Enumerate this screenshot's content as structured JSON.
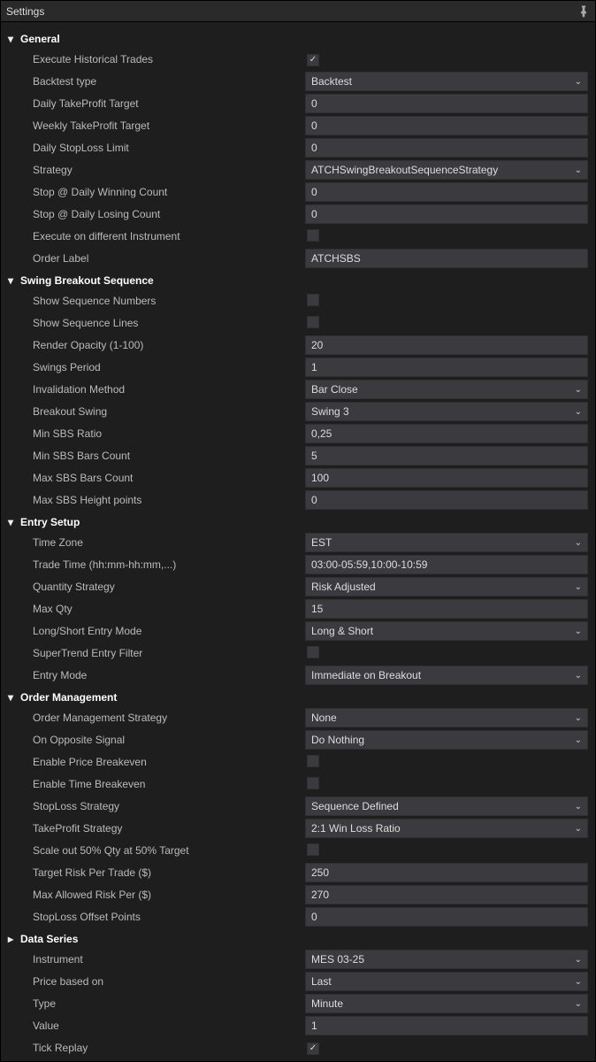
{
  "window": {
    "title": "Settings"
  },
  "sections": {
    "general": {
      "title": "General",
      "execute_historical_trades": {
        "label": "Execute Historical Trades",
        "checked": true
      },
      "backtest_type": {
        "label": "Backtest type",
        "value": "Backtest"
      },
      "daily_tp_target": {
        "label": "Daily TakeProfit Target",
        "value": "0"
      },
      "weekly_tp_target": {
        "label": "Weekly TakeProfit Target",
        "value": "0"
      },
      "daily_sl_limit": {
        "label": "Daily StopLoss Limit",
        "value": "0"
      },
      "strategy": {
        "label": "Strategy",
        "value": "ATCHSwingBreakoutSequenceStrategy"
      },
      "stop_daily_win": {
        "label": "Stop @ Daily Winning Count",
        "value": "0"
      },
      "stop_daily_lose": {
        "label": "Stop @ Daily Losing Count",
        "value": "0"
      },
      "exec_diff_instrument": {
        "label": "Execute on different Instrument",
        "checked": false
      },
      "order_label": {
        "label": "Order Label",
        "value": "ATCHSBS"
      }
    },
    "sbs": {
      "title": "Swing Breakout Sequence",
      "show_seq_numbers": {
        "label": "Show Sequence Numbers",
        "checked": false
      },
      "show_seq_lines": {
        "label": "Show Sequence Lines",
        "checked": false
      },
      "render_opacity": {
        "label": "Render Opacity (1-100)",
        "value": "20"
      },
      "swings_period": {
        "label": "Swings Period",
        "value": "1"
      },
      "invalidation_method": {
        "label": "Invalidation Method",
        "value": "Bar Close"
      },
      "breakout_swing": {
        "label": "Breakout Swing",
        "value": "Swing 3"
      },
      "min_sbs_ratio": {
        "label": "Min SBS Ratio",
        "value": "0,25"
      },
      "min_sbs_bars": {
        "label": "Min SBS Bars Count",
        "value": "5"
      },
      "max_sbs_bars": {
        "label": "Max SBS Bars Count",
        "value": "100"
      },
      "max_sbs_height": {
        "label": "Max SBS Height points",
        "value": "0"
      }
    },
    "entry": {
      "title": "Entry Setup",
      "time_zone": {
        "label": "Time Zone",
        "value": "EST"
      },
      "trade_time": {
        "label": "Trade Time (hh:mm-hh:mm,...)",
        "value": "03:00-05:59,10:00-10:59"
      },
      "qty_strategy": {
        "label": "Quantity Strategy",
        "value": "Risk Adjusted"
      },
      "max_qty": {
        "label": "Max Qty",
        "value": "15"
      },
      "long_short": {
        "label": "Long/Short Entry Mode",
        "value": "Long & Short"
      },
      "supertrend_filter": {
        "label": "SuperTrend Entry Filter",
        "checked": false
      },
      "entry_mode": {
        "label": "Entry Mode",
        "value": "Immediate on Breakout"
      }
    },
    "order_mgmt": {
      "title": "Order Management",
      "oms": {
        "label": "Order Management Strategy",
        "value": "None"
      },
      "opposite_signal": {
        "label": "On Opposite Signal",
        "value": "Do Nothing"
      },
      "enable_price_be": {
        "label": "Enable Price Breakeven",
        "checked": false
      },
      "enable_time_be": {
        "label": "Enable Time Breakeven",
        "checked": false
      },
      "sl_strategy": {
        "label": "StopLoss Strategy",
        "value": "Sequence Defined"
      },
      "tp_strategy": {
        "label": "TakeProfit Strategy",
        "value": "2:1 Win Loss Ratio"
      },
      "scale_out": {
        "label": "Scale out 50% Qty at 50% Target",
        "checked": false
      },
      "target_risk": {
        "label": "Target Risk Per Trade ($)",
        "value": "250"
      },
      "max_allowed_risk": {
        "label": "Max Allowed Risk Per ($)",
        "value": "270"
      },
      "sl_offset": {
        "label": "StopLoss Offset Points",
        "value": "0"
      }
    },
    "data_series": {
      "title": "Data Series",
      "instrument": {
        "label": "Instrument",
        "value": "MES 03-25"
      },
      "price_based_on": {
        "label": "Price based on",
        "value": "Last"
      },
      "type": {
        "label": "Type",
        "value": "Minute"
      },
      "value": {
        "label": "Value",
        "value": "1"
      },
      "tick_replay": {
        "label": "Tick Replay",
        "checked": true
      }
    }
  }
}
